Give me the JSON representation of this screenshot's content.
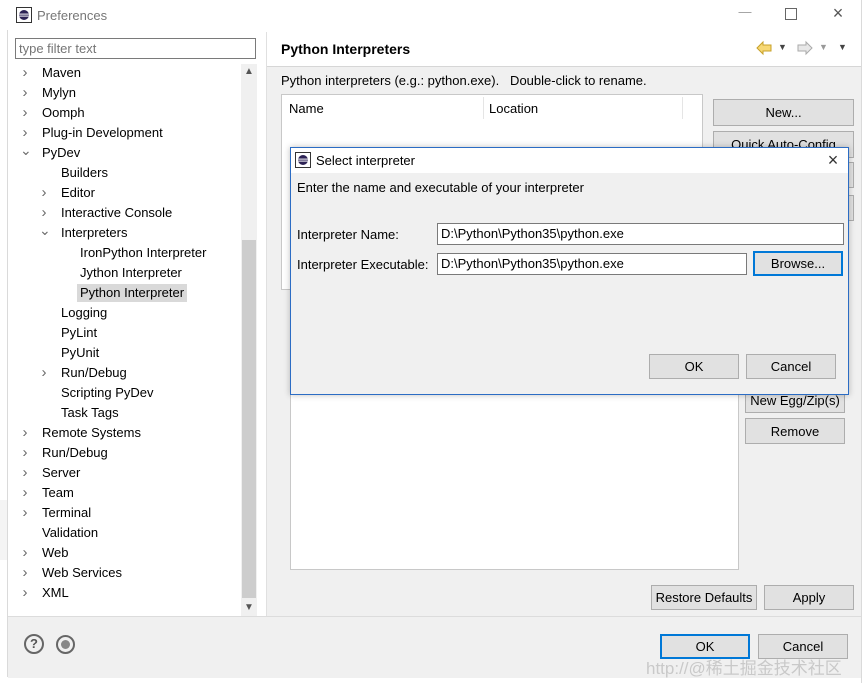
{
  "window": {
    "title": "Preferences"
  },
  "filter": {
    "placeholder": "type filter text"
  },
  "tree": [
    {
      "label": "Maven",
      "level": 0,
      "arrow": "›"
    },
    {
      "label": "Mylyn",
      "level": 0,
      "arrow": "›"
    },
    {
      "label": "Oomph",
      "level": 0,
      "arrow": "›"
    },
    {
      "label": "Plug-in Development",
      "level": 0,
      "arrow": "›"
    },
    {
      "label": "PyDev",
      "level": 0,
      "arrow": "⌄"
    },
    {
      "label": "Builders",
      "level": 1,
      "arrow": ""
    },
    {
      "label": "Editor",
      "level": 1,
      "arrow": "›"
    },
    {
      "label": "Interactive Console",
      "level": 1,
      "arrow": "›"
    },
    {
      "label": "Interpreters",
      "level": 1,
      "arrow": "⌄"
    },
    {
      "label": "IronPython Interpreter",
      "level": 2,
      "arrow": ""
    },
    {
      "label": "Jython Interpreter",
      "level": 2,
      "arrow": ""
    },
    {
      "label": "Python Interpreter",
      "level": 2,
      "arrow": "",
      "selected": true
    },
    {
      "label": "Logging",
      "level": 1,
      "arrow": ""
    },
    {
      "label": "PyLint",
      "level": 1,
      "arrow": ""
    },
    {
      "label": "PyUnit",
      "level": 1,
      "arrow": ""
    },
    {
      "label": "Run/Debug",
      "level": 1,
      "arrow": "›"
    },
    {
      "label": "Scripting PyDev",
      "level": 1,
      "arrow": ""
    },
    {
      "label": "Task Tags",
      "level": 1,
      "arrow": ""
    },
    {
      "label": "Remote Systems",
      "level": 0,
      "arrow": "›"
    },
    {
      "label": "Run/Debug",
      "level": 0,
      "arrow": "›"
    },
    {
      "label": "Server",
      "level": 0,
      "arrow": "›"
    },
    {
      "label": "Team",
      "level": 0,
      "arrow": "›"
    },
    {
      "label": "Terminal",
      "level": 0,
      "arrow": "›"
    },
    {
      "label": "Validation",
      "level": 0,
      "arrow": ""
    },
    {
      "label": "Web",
      "level": 0,
      "arrow": "›"
    },
    {
      "label": "Web Services",
      "level": 0,
      "arrow": "›"
    },
    {
      "label": "XML",
      "level": 0,
      "arrow": "›"
    }
  ],
  "page": {
    "title": "Python Interpreters",
    "description": "Python interpreters (e.g.: python.exe).   Double-click to rename.",
    "columns": {
      "name": "Name",
      "location": "Location"
    },
    "buttons": {
      "new": "New...",
      "quick_auto_config": "Quick Auto-Config",
      "new_egg_zip": "New Egg/Zip(s)",
      "remove": "Remove"
    },
    "restore_defaults": "Restore Defaults",
    "apply": "Apply"
  },
  "footer": {
    "ok": "OK",
    "cancel": "Cancel",
    "watermark": "http://@稀土掘金技术社区"
  },
  "dialog": {
    "title": "Select interpreter",
    "instruction": "Enter the name and executable of your interpreter",
    "name_label": "Interpreter Name:",
    "name_value": "D:\\Python\\Python35\\python.exe",
    "exec_label": "Interpreter Executable:",
    "exec_value": "D:\\Python\\Python35\\python.exe",
    "browse": "Browse...",
    "ok": "OK",
    "cancel": "Cancel"
  },
  "colors": {
    "accent": "#0078d7",
    "selection": "#d9d9d9",
    "panel": "#f0f0f0"
  }
}
